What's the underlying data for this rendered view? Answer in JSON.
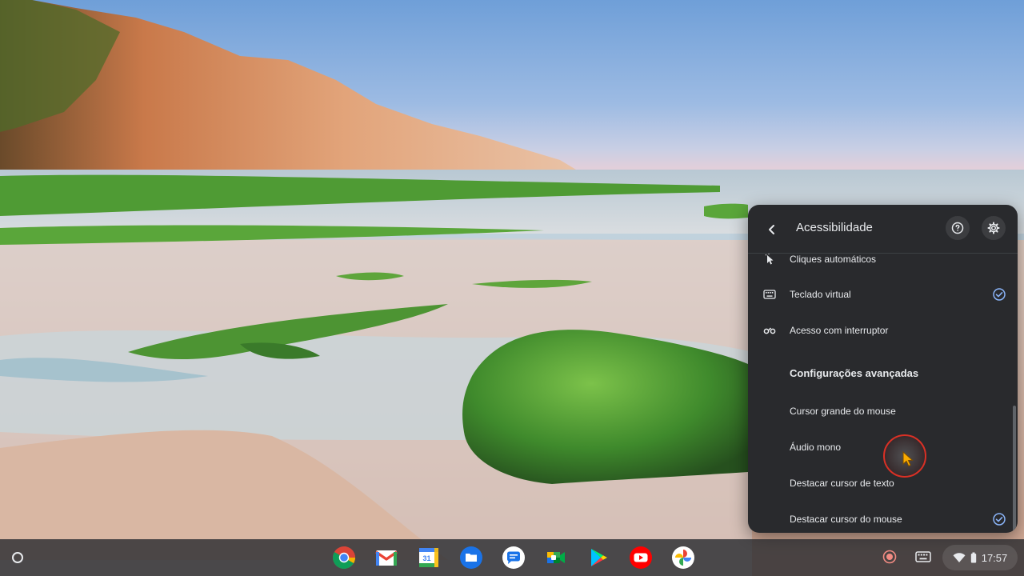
{
  "panel": {
    "title": "Acessibilidade",
    "items": [
      {
        "label": "Cliques automáticos",
        "icon": "auto-click-icon",
        "checked": false
      },
      {
        "label": "Teclado virtual",
        "icon": "keyboard-icon",
        "checked": true
      },
      {
        "label": "Acesso com interruptor",
        "icon": "switch-access-icon",
        "checked": false
      }
    ],
    "advanced": {
      "title": "Configurações avançadas",
      "items": [
        {
          "label": "Cursor grande do mouse",
          "checked": false
        },
        {
          "label": "Áudio mono",
          "checked": false
        },
        {
          "label": "Destacar cursor de texto",
          "checked": false
        },
        {
          "label": "Destacar cursor do mouse",
          "checked": true
        }
      ]
    }
  },
  "shelf": {
    "apps": [
      "Chrome",
      "Gmail",
      "Calendar",
      "Files",
      "Messages",
      "Meet",
      "Play Store",
      "YouTube",
      "Photos"
    ],
    "clock": "17:57"
  },
  "colors": {
    "panel_bg": "#292a2d",
    "accent_check": "#8ab4f8",
    "record": "#f28b82"
  }
}
